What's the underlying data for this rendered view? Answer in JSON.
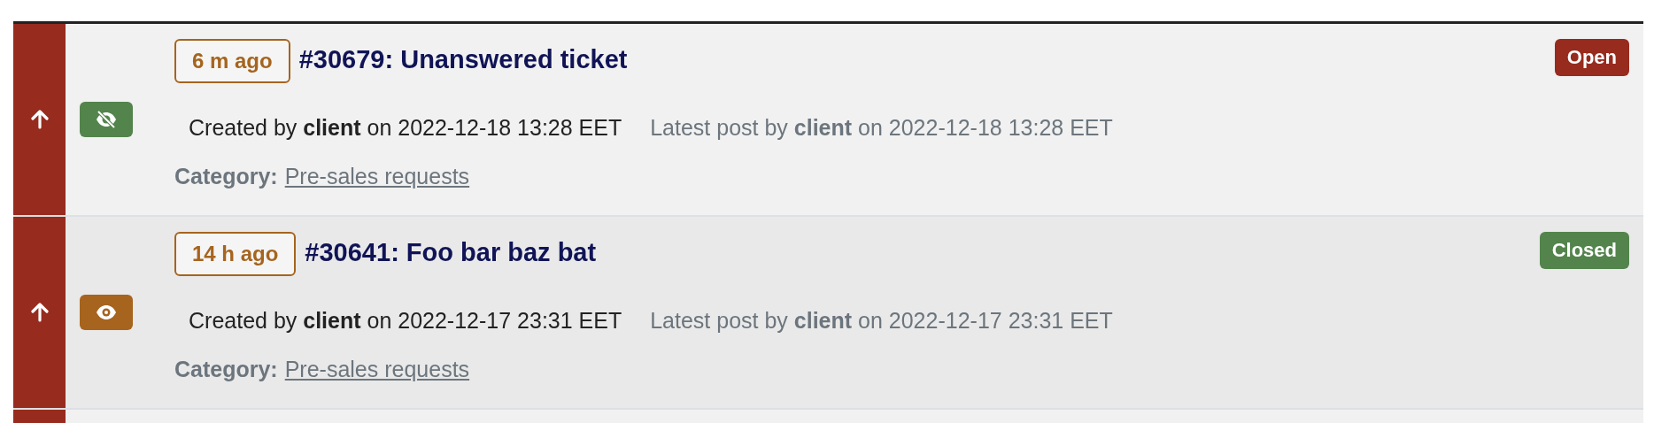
{
  "tickets": [
    {
      "age": "6 m ago",
      "title": "#30679: Unanswered ticket",
      "status": {
        "label": "Open",
        "kind": "open"
      },
      "viewed": false,
      "created": "Created by **client** on 2022-12-18 13:28 EET",
      "latest": "Latest post by **client** on 2022-12-18 13:28 EET",
      "category_label": "Category:",
      "category": "Pre-sales requests"
    },
    {
      "age": "14 h ago",
      "title": "#30641: Foo bar baz bat",
      "status": {
        "label": "Closed",
        "kind": "closed"
      },
      "viewed": true,
      "created": "Created by **client** on 2022-12-17 23:31 EET",
      "latest": "Latest post by **client** on 2022-12-17 23:31 EET",
      "category_label": "Category:",
      "category": "Pre-sales requests"
    }
  ]
}
